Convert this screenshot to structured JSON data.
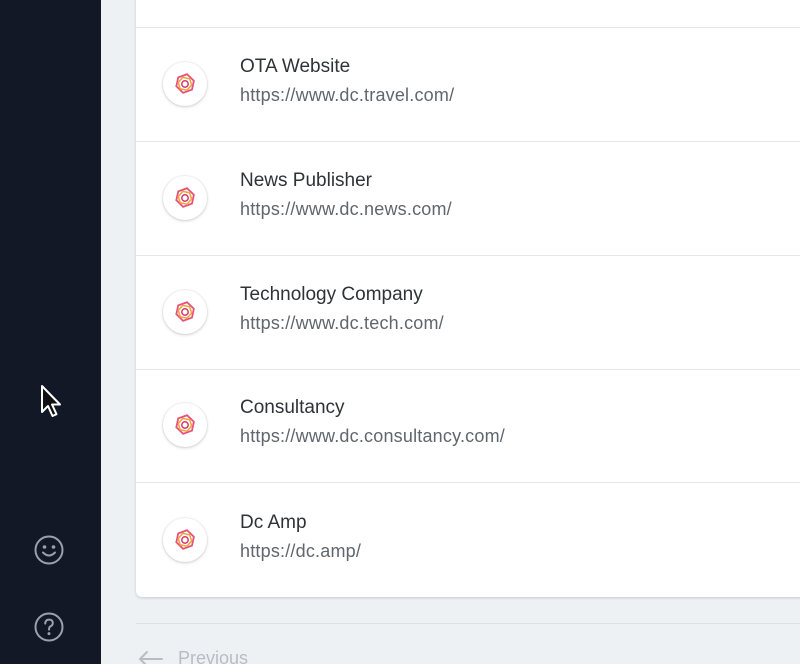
{
  "sidebar": {
    "icons": [
      "smiley-icon",
      "help-circle-icon"
    ]
  },
  "sites": [
    {
      "name": "OTA Website",
      "url": "https://www.dc.travel.com/"
    },
    {
      "name": "News Publisher",
      "url": "https://www.dc.news.com/"
    },
    {
      "name": "Technology Company",
      "url": "https://www.dc.tech.com/"
    },
    {
      "name": "Consultancy",
      "url": "https://www.dc.consultancy.com/"
    },
    {
      "name": "Dc Amp",
      "url": "https://dc.amp/"
    }
  ],
  "pagination": {
    "previous_label": "Previous"
  },
  "colors": {
    "sidebar_bg": "#121826",
    "logo_accent": "#e8507a",
    "logo_accent_2": "#f2a23a"
  }
}
